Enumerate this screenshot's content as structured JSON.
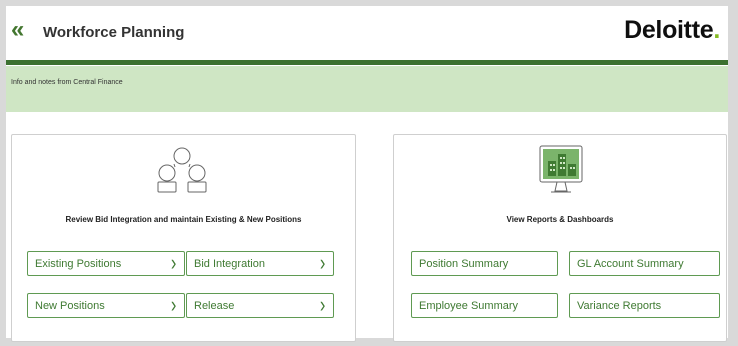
{
  "header": {
    "back_icon": "double-chevron-left-icon",
    "back_glyph": "«",
    "title": "Workforce Planning",
    "logo_text": "Deloitte",
    "logo_dot": ".",
    "accent_color": "#43762f",
    "logo_dot_color": "#86bc25"
  },
  "banner": {
    "text": "Info and notes from Central Finance",
    "background": "#cfe6c4"
  },
  "left_card": {
    "icon": "people-group-icon",
    "title": "Review Bid Integration and maintain Existing & New Positions",
    "buttons": [
      {
        "label": "Existing Positions",
        "chevron": "›"
      },
      {
        "label": "Bid Integration",
        "chevron": "›"
      },
      {
        "label": "New Positions",
        "chevron": "›"
      },
      {
        "label": "Release",
        "chevron": "›"
      }
    ]
  },
  "right_card": {
    "icon": "monitor-dashboard-icon",
    "title": "View Reports & Dashboards",
    "buttons": [
      {
        "label": "Position Summary"
      },
      {
        "label": "GL Account Summary"
      },
      {
        "label": "Employee Summary"
      },
      {
        "label": "Variance Reports"
      }
    ]
  }
}
